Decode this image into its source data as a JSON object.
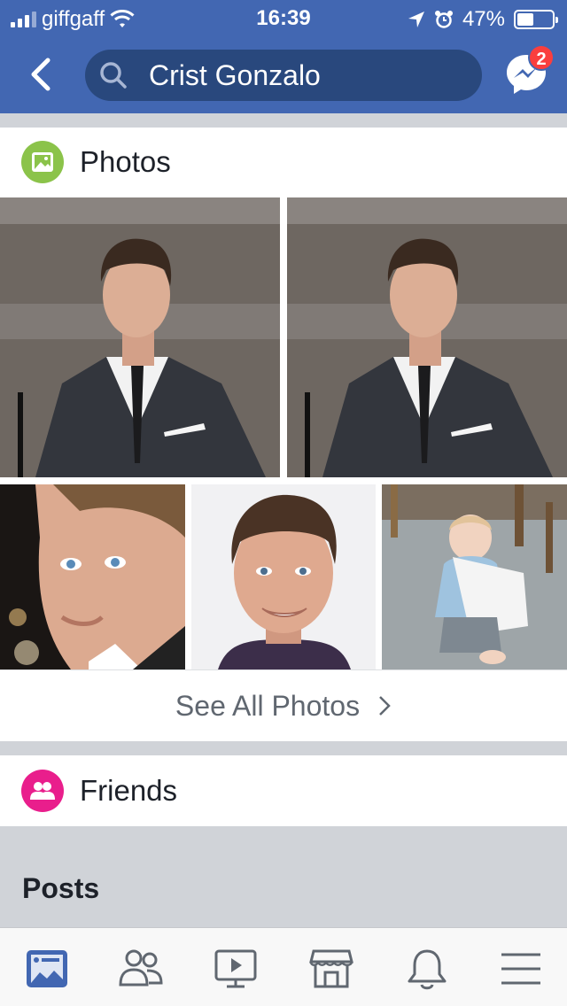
{
  "status_bar": {
    "carrier": "giffgaff",
    "time": "16:39",
    "battery_percent": "47%",
    "battery_level": 0.47
  },
  "header": {
    "search_query": "Crist Gonzalo",
    "messenger_badge": "2",
    "icons": [
      "back-chevron-icon",
      "search-icon",
      "messenger-icon"
    ],
    "colors": {
      "brand": "#4267b2",
      "search_bg": "#29487d",
      "badge": "#fa3e3e"
    }
  },
  "photos": {
    "title": "Photos",
    "see_all": "See All Photos",
    "icon": "photo-icon",
    "icon_color": "#8bc34a"
  },
  "friends": {
    "title": "Friends",
    "icon": "friends-icon",
    "icon_color": "#e91e8c"
  },
  "posts": {
    "title": "Posts"
  },
  "tab_bar": {
    "tabs": [
      "news-feed-icon",
      "friends-icon",
      "watch-icon",
      "marketplace-icon",
      "notifications-icon",
      "menu-icon"
    ],
    "active_tab": "news-feed-icon"
  }
}
